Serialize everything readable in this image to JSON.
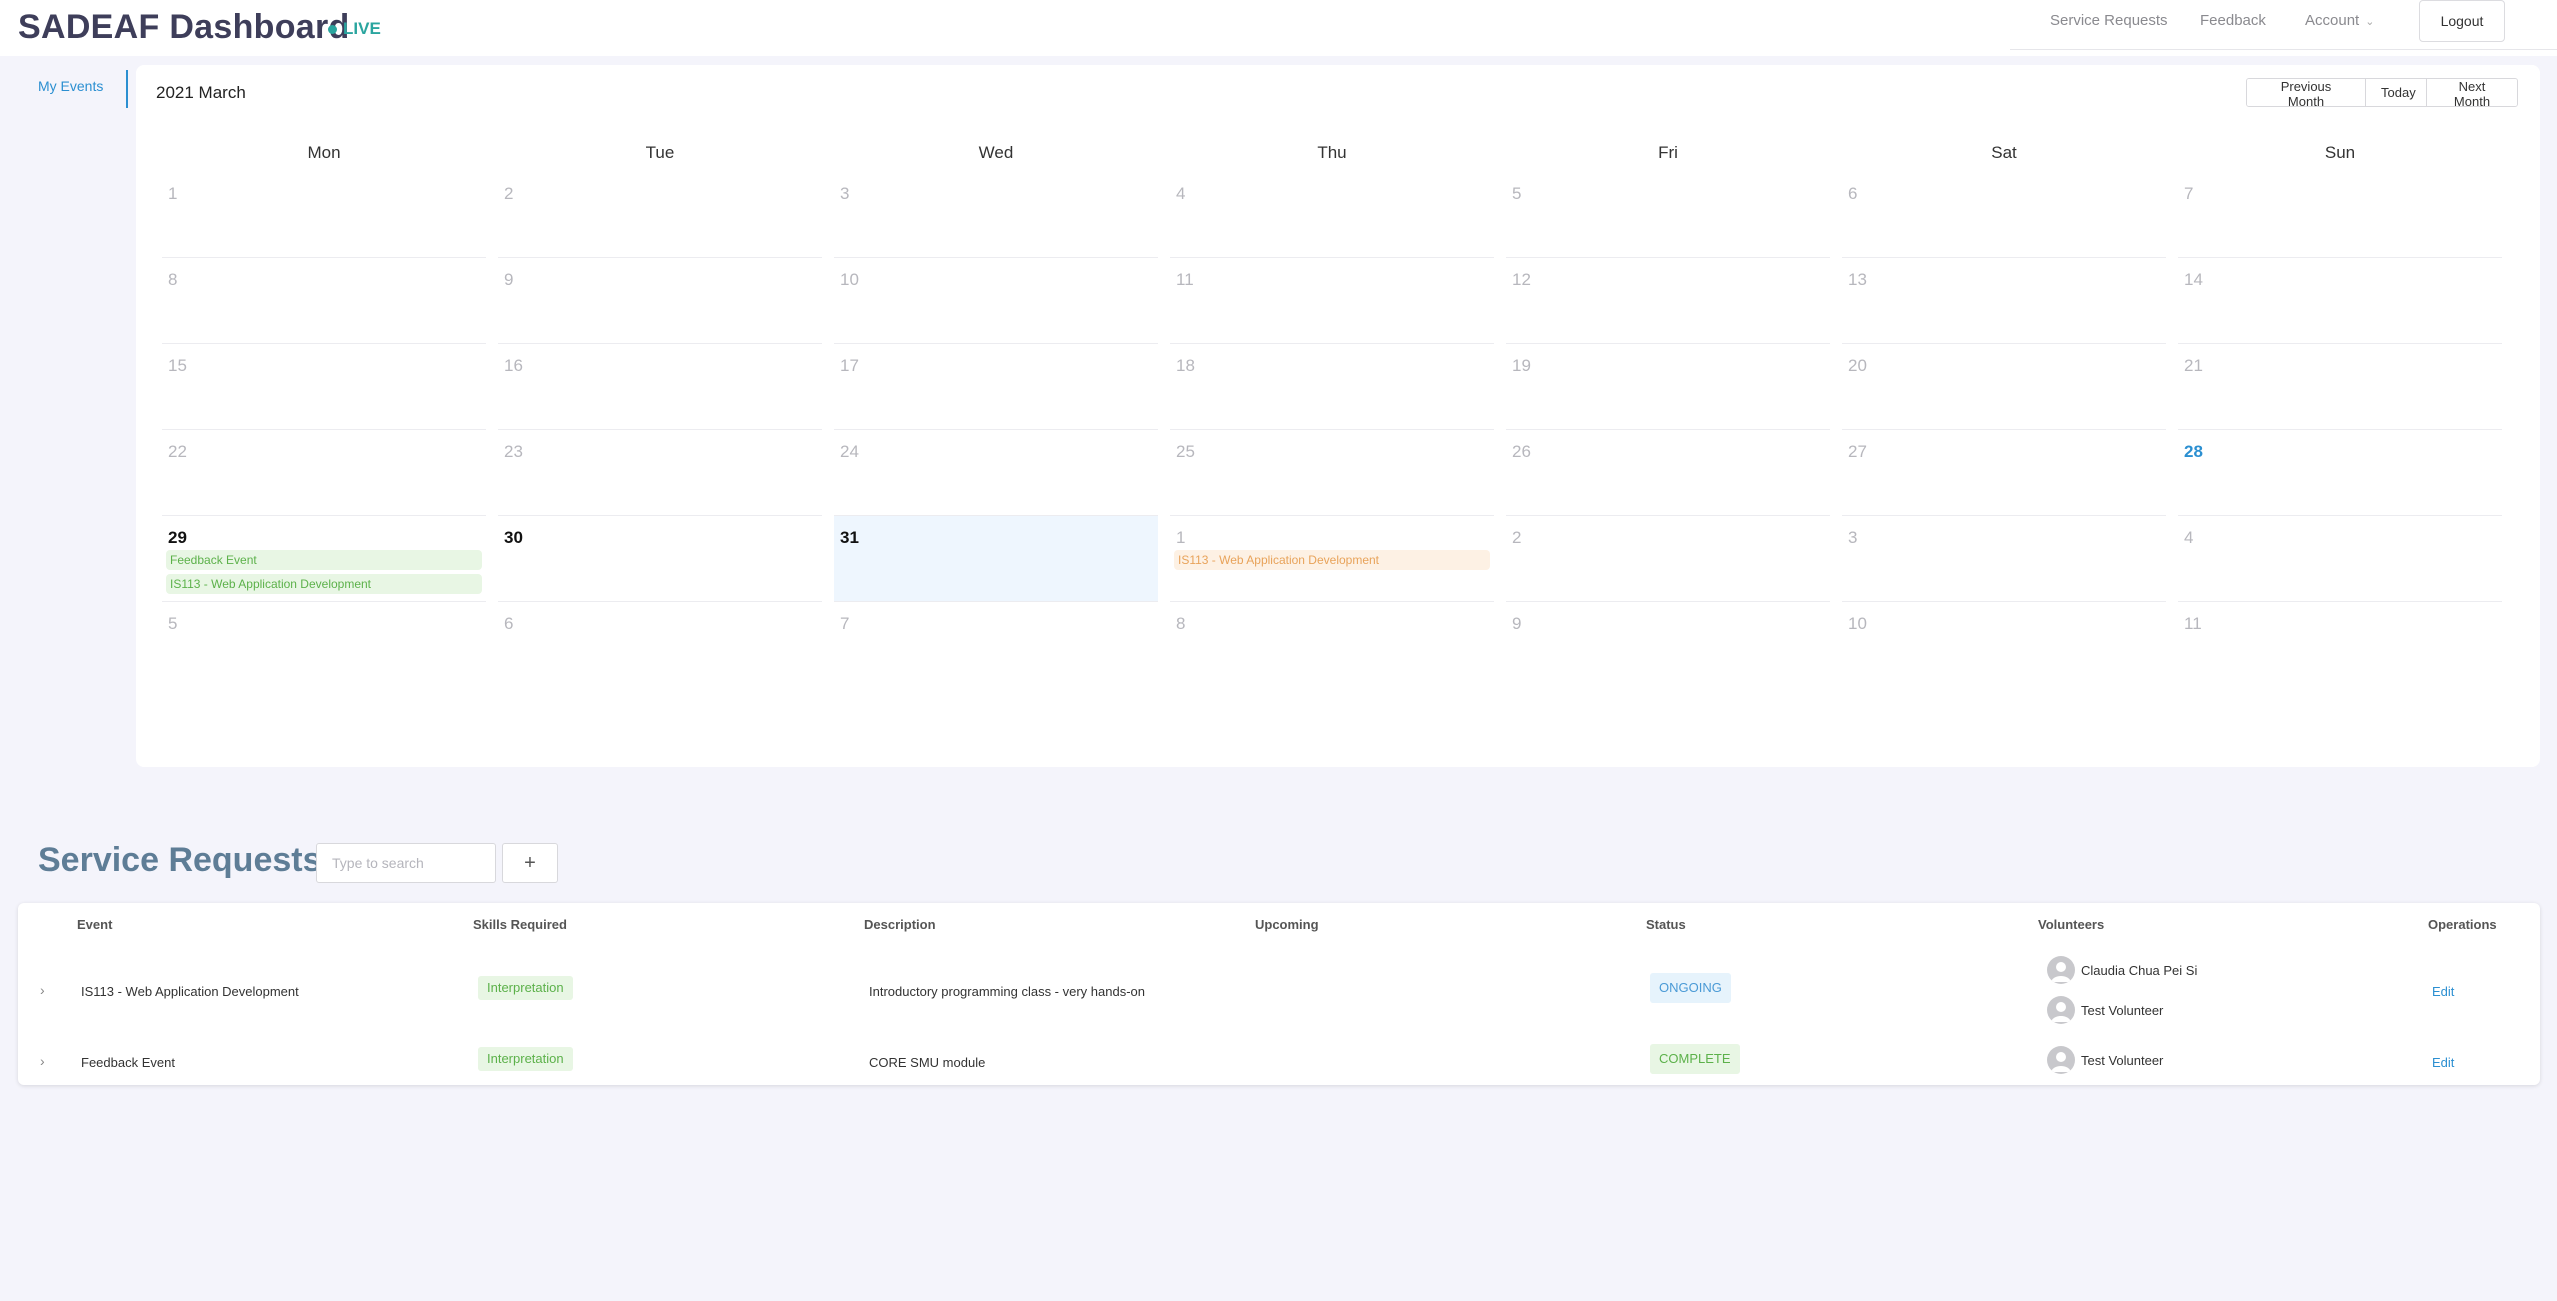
{
  "header": {
    "title": "SADEAF Dashboard",
    "live": "LIVE",
    "nav": {
      "service_requests": "Service Requests",
      "feedback": "Feedback",
      "account": "Account"
    },
    "logout": "Logout"
  },
  "sidebar": {
    "my_events": "My Events"
  },
  "calendar": {
    "title": "2021 March",
    "buttons": {
      "prev": "Previous Month",
      "today": "Today",
      "next": "Next Month"
    },
    "weekdays": [
      "Mon",
      "Tue",
      "Wed",
      "Thu",
      "Fri",
      "Sat",
      "Sun"
    ],
    "weeks": [
      [
        "1",
        "2",
        "3",
        "4",
        "5",
        "6",
        "7"
      ],
      [
        "8",
        "9",
        "10",
        "11",
        "12",
        "13",
        "14"
      ],
      [
        "15",
        "16",
        "17",
        "18",
        "19",
        "20",
        "21"
      ],
      [
        "22",
        "23",
        "24",
        "25",
        "26",
        "27",
        "28"
      ],
      [
        "29",
        "30",
        "31",
        "1",
        "2",
        "3",
        "4"
      ],
      [
        "5",
        "6",
        "7",
        "8",
        "9",
        "10",
        "11"
      ]
    ],
    "today_label": "28",
    "events": {
      "mon29_a": "Feedback Event",
      "mon29_b": "IS113 - Web Application Development",
      "thu1": "IS113 - Web Application Development"
    },
    "colors": {
      "event_green": "#5cb14a",
      "event_orange": "#e8a35a",
      "today": "#2b8fd1"
    }
  },
  "service_requests": {
    "title": "Service Requests",
    "search_placeholder": "Type to search",
    "add_label": "+",
    "columns": [
      "Event",
      "Skills Required",
      "Description",
      "Upcoming",
      "Status",
      "Volunteers",
      "Operations"
    ],
    "rows": [
      {
        "event": "IS113 - Web Application Development",
        "skill": "Interpretation",
        "description": "Introductory programming class - very hands-on",
        "upcoming": "",
        "status": "ONGOING",
        "volunteers": [
          "Claudia Chua Pei Si",
          "Test Volunteer"
        ],
        "operation": "Edit"
      },
      {
        "event": "Feedback Event",
        "skill": "Interpretation",
        "description": "CORE SMU module",
        "upcoming": "",
        "status": "COMPLETE",
        "volunteers": [
          "Test Volunteer"
        ],
        "operation": "Edit"
      }
    ],
    "expand_icon": "chevron-right-icon"
  }
}
